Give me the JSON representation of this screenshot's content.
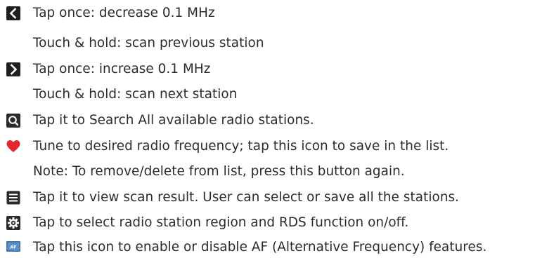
{
  "instructions": {
    "prev": {
      "icon": "chevron-left-icon",
      "line1": "Tap once: decrease 0.1 MHz",
      "line2": "Touch & hold: scan previous station"
    },
    "next": {
      "icon": "chevron-right-icon",
      "line1": "Tap once: increase 0.1 MHz",
      "line2": "Touch & hold: scan next station"
    },
    "search": {
      "icon": "search-icon",
      "line1": "Tap it to Search All available radio stations."
    },
    "favorite": {
      "icon": "heart-icon",
      "line1": "Tune to desired radio frequency; tap this icon to save in the list.",
      "line2": "Note: To remove/delete from list, press this button again."
    },
    "list": {
      "icon": "list-icon",
      "line1": "Tap it to view scan result. User can select or save all the stations."
    },
    "settings": {
      "icon": "gear-icon",
      "line1": "Tap to select radio station region and RDS function on/off."
    },
    "af": {
      "icon": "af-icon",
      "icon_text": "AF",
      "line1": "Tap this icon to enable or disable AF (Alternative Frequency) features."
    }
  },
  "colors": {
    "text": "#2b2b2b",
    "icon_dark": "#1f1f1f",
    "heart": "#e3262f",
    "af_blue": "#3a6ea8"
  }
}
